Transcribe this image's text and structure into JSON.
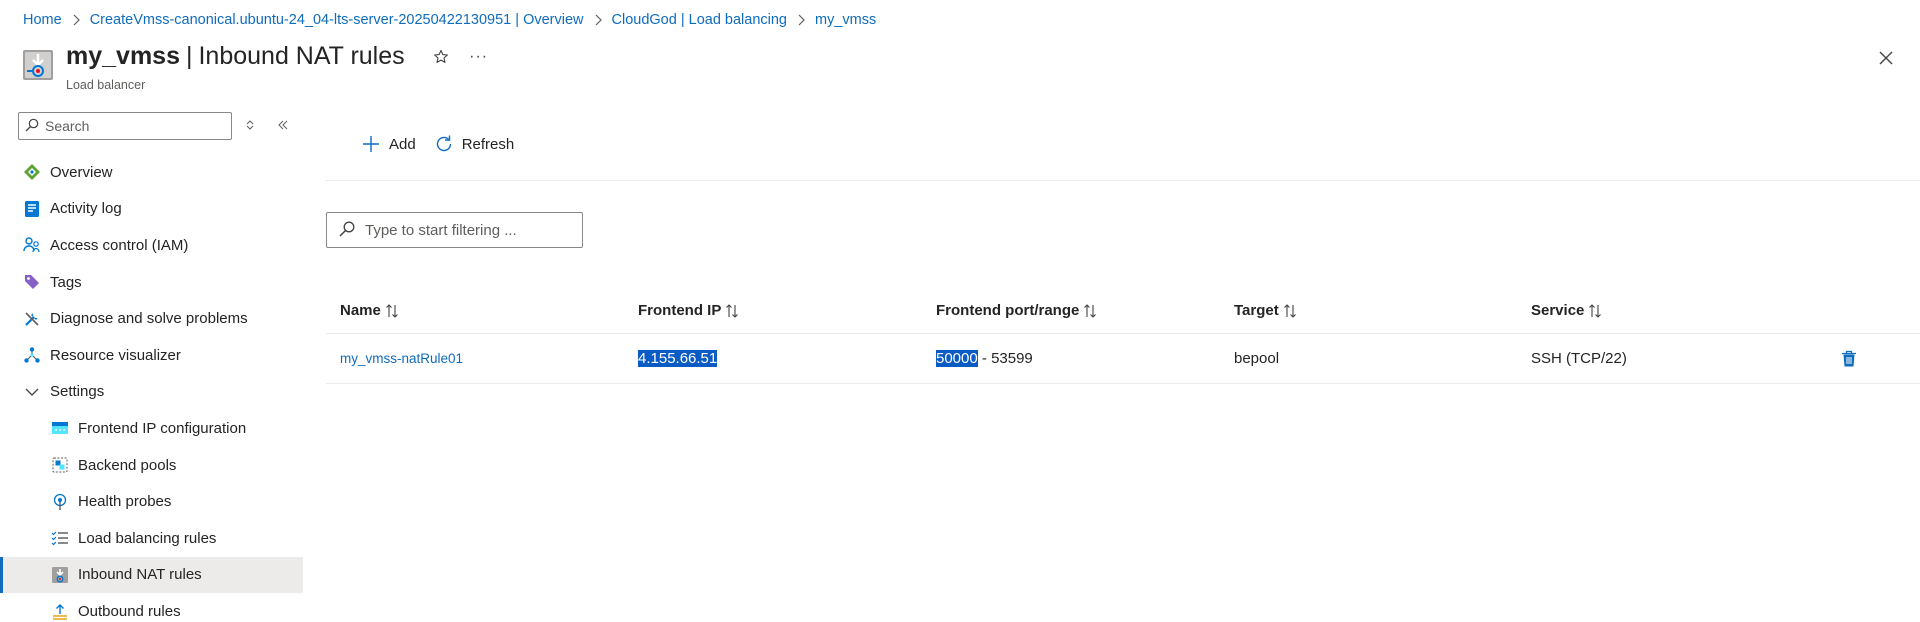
{
  "breadcrumb": [
    {
      "label": "Home"
    },
    {
      "label": "CreateVmss-canonical.ubuntu-24_04-lts-server-20250422130951 | Overview"
    },
    {
      "label": "CloudGod | Load balancing"
    },
    {
      "label": "my_vmss"
    }
  ],
  "header": {
    "resource_name": "my_vmss",
    "separator": "|",
    "page_title": "Inbound NAT rules",
    "subtitle": "Load balancer",
    "more_label": "···"
  },
  "sidebar": {
    "search_placeholder": "Search",
    "items": [
      {
        "label": "Overview",
        "icon": "overview-icon"
      },
      {
        "label": "Activity log",
        "icon": "activity-log-icon"
      },
      {
        "label": "Access control (IAM)",
        "icon": "iam-icon"
      },
      {
        "label": "Tags",
        "icon": "tag-icon"
      },
      {
        "label": "Diagnose and solve problems",
        "icon": "diagnose-icon"
      },
      {
        "label": "Resource visualizer",
        "icon": "visualizer-icon"
      },
      {
        "label": "Settings",
        "icon": "chevron-down-icon"
      },
      {
        "label": "Frontend IP configuration",
        "icon": "frontend-ip-icon"
      },
      {
        "label": "Backend pools",
        "icon": "backend-pools-icon"
      },
      {
        "label": "Health probes",
        "icon": "health-probe-icon"
      },
      {
        "label": "Load balancing rules",
        "icon": "lb-rules-icon"
      },
      {
        "label": "Inbound NAT rules",
        "icon": "inbound-nat-icon"
      },
      {
        "label": "Outbound rules",
        "icon": "outbound-rules-icon"
      }
    ]
  },
  "toolbar": {
    "add_label": "Add",
    "refresh_label": "Refresh"
  },
  "filter": {
    "placeholder": "Type to start filtering ..."
  },
  "table": {
    "columns": [
      "Name",
      "Frontend IP",
      "Frontend port/range",
      "Target",
      "Service"
    ],
    "rows": [
      {
        "name": "my_vmss-natRule01",
        "frontend_ip": "4.155.66.51",
        "port_start": "50000",
        "port_sep": " - ",
        "port_end": "53599",
        "target": "bepool",
        "service": "SSH (TCP/22)"
      }
    ]
  },
  "colors": {
    "accent": "#0f6cbd",
    "selection": "#0a5bc4",
    "active_nav": "#edebe9"
  }
}
